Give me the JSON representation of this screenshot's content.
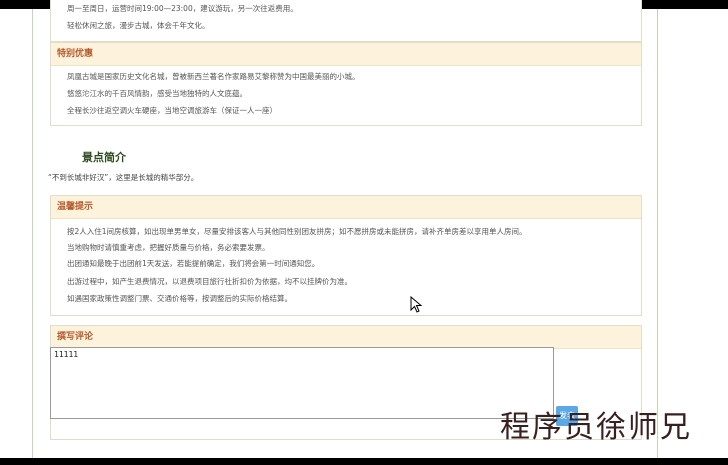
{
  "top_box": {
    "partial_line": "周一至周日，运营时间19:00—23:00，建议游玩，另一次往返费用。",
    "line2": "轻松休闲之旅，漫步古城，体会千年文化。"
  },
  "special_offer": {
    "title": "特别优惠",
    "lines": [
      "凤凰古城是国家历史文化名城，曾被新西兰著名作家路易艾黎称赞为中国最美丽的小城。",
      "悠悠沱江水的千百风情韵，感受当地独特的人文底蕴。",
      "全程长沙往返空调火车硬座，当地空调旅游车（保证一人一座）"
    ]
  },
  "intro": {
    "title": "景点简介",
    "text": "“不到长城非好汉”，这里是长城的精华部分。"
  },
  "tips": {
    "title": "温馨提示",
    "lines": [
      "按2人入住1间房核算，如出现单男单女，尽量安排该客人与其他同性别团友拼房；如不愿拼房或未能拼房，请补齐单房差以享用单人房间。",
      "当地购物时请慎重考虑，把握好质量与价格，务必索要发票。",
      "出团通知最晚于出团前1天发送，若能提前确定，我们将会第一时间通知您。",
      "出游过程中，如产生退费情况，以退费项目旅行社折扣价为依据，均不以挂牌价为准。",
      "如遇国家政策性调整门票、交通价格等，按调整后的实际价格结算。"
    ]
  },
  "comment": {
    "title": "撰写评论",
    "value": "11111",
    "submit_label": "发表"
  },
  "watermark": "程序员徐师兄"
}
